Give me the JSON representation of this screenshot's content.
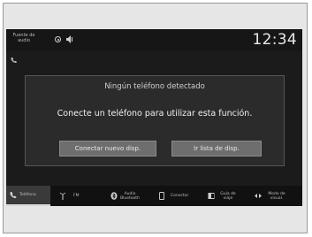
{
  "status_bar": {
    "audio_source": "Fuente de audio",
    "clock": "12:34"
  },
  "dialog": {
    "title": "Ningún teléfono detectado",
    "message": "Conecte un teléfono para utilizar esta función.",
    "connect_button": "Conectar nuevo disp.",
    "list_button": "Ir lista de disp."
  },
  "bottom_bar": {
    "items": [
      {
        "label": "Teléfono",
        "icon": "phone-icon"
      },
      {
        "label": "FM",
        "icon": "antenna-icon"
      },
      {
        "label": "Audio Bluetooth",
        "icon": "bluetooth-icon"
      },
      {
        "label": "Conectar",
        "icon": "smartphone-icon"
      },
      {
        "label": "Guía de viaje",
        "icon": "book-icon"
      },
      {
        "label": "Modo de visual.",
        "icon": "display-mode-icon"
      }
    ],
    "active_index": 0
  },
  "colors": {
    "screen_bg": "#1b1b1b",
    "dialog_bg": "#2b2b2b",
    "button_bg": "#6e6e6e",
    "frame_bg": "#e6e6e6"
  }
}
